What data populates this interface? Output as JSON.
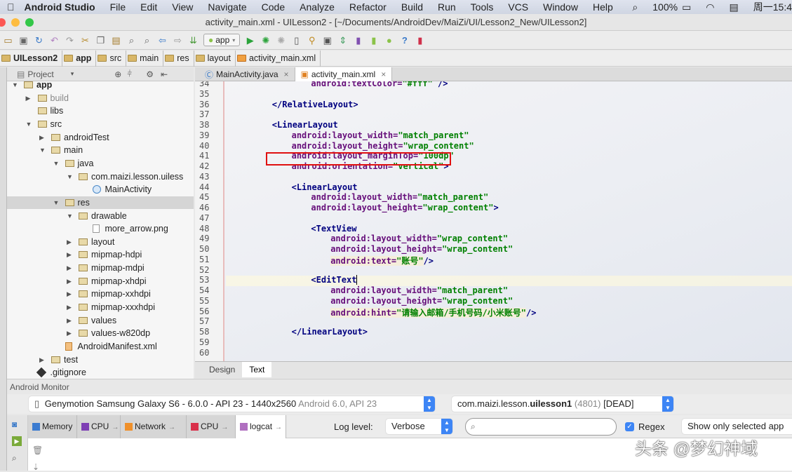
{
  "menubar": {
    "apple": "",
    "app_name": "Android Studio",
    "items": [
      "File",
      "Edit",
      "View",
      "Navigate",
      "Code",
      "Analyze",
      "Refactor",
      "Build",
      "Run",
      "Tools",
      "VCS",
      "Window",
      "Help"
    ],
    "battery": "100%",
    "clock": "周一15:4"
  },
  "window": {
    "title": "activity_main.xml - UILesson2 - [~/Documents/AndroidDev/MaiZi/UI/Lesson2_New/UILesson2]"
  },
  "toolbar": {
    "run_config": "app",
    "help": "?"
  },
  "breadcrumb": [
    "UILesson2",
    "app",
    "src",
    "main",
    "res",
    "layout",
    "activity_main.xml"
  ],
  "project_panel": {
    "view_selector": "Project"
  },
  "tree": [
    {
      "label": "app",
      "depth": 0,
      "arrow": "open",
      "bold": true
    },
    {
      "label": "build",
      "depth": 1,
      "arrow": "closed",
      "muted": true
    },
    {
      "label": "libs",
      "depth": 1,
      "arrow": "none"
    },
    {
      "label": "src",
      "depth": 1,
      "arrow": "open"
    },
    {
      "label": "androidTest",
      "depth": 2,
      "arrow": "closed"
    },
    {
      "label": "main",
      "depth": 2,
      "arrow": "open"
    },
    {
      "label": "java",
      "depth": 3,
      "arrow": "open"
    },
    {
      "label": "com.maizi.lesson.uiless",
      "depth": 4,
      "arrow": "open"
    },
    {
      "label": "MainActivity",
      "depth": 5,
      "arrow": "none",
      "icon": "class"
    },
    {
      "label": "res",
      "depth": 3,
      "arrow": "open",
      "selected": true
    },
    {
      "label": "drawable",
      "depth": 4,
      "arrow": "open"
    },
    {
      "label": "more_arrow.png",
      "depth": 5,
      "arrow": "none",
      "icon": "image"
    },
    {
      "label": "layout",
      "depth": 4,
      "arrow": "closed"
    },
    {
      "label": "mipmap-hdpi",
      "depth": 4,
      "arrow": "closed"
    },
    {
      "label": "mipmap-mdpi",
      "depth": 4,
      "arrow": "closed"
    },
    {
      "label": "mipmap-xhdpi",
      "depth": 4,
      "arrow": "closed"
    },
    {
      "label": "mipmap-xxhdpi",
      "depth": 4,
      "arrow": "closed"
    },
    {
      "label": "mipmap-xxxhdpi",
      "depth": 4,
      "arrow": "closed"
    },
    {
      "label": "values",
      "depth": 4,
      "arrow": "closed"
    },
    {
      "label": "values-w820dp",
      "depth": 4,
      "arrow": "closed"
    },
    {
      "label": "AndroidManifest.xml",
      "depth": 3,
      "arrow": "none",
      "icon": "manifest"
    },
    {
      "label": "test",
      "depth": 2,
      "arrow": "closed"
    },
    {
      "label": ".gitignore",
      "depth": 1,
      "arrow": "none",
      "icon": "git"
    }
  ],
  "editor_tabs": [
    {
      "label": "MainActivity.java",
      "active": false
    },
    {
      "label": "activity_main.xml",
      "active": true
    }
  ],
  "code": {
    "current_line": 53,
    "highlighted_line": 41,
    "lines": [
      {
        "n": 34,
        "indent": 3,
        "parts": [
          {
            "k": "attr",
            "t": "android:textColor="
          },
          {
            "k": "val",
            "t": "\"#fff\""
          },
          {
            "k": "tag",
            "t": " />"
          }
        ]
      },
      {
        "n": 35,
        "indent": 0,
        "parts": []
      },
      {
        "n": 36,
        "indent": 1,
        "parts": [
          {
            "k": "tag",
            "t": "</RelativeLayout>"
          }
        ]
      },
      {
        "n": 37,
        "indent": 0,
        "parts": []
      },
      {
        "n": 38,
        "indent": 1,
        "parts": [
          {
            "k": "tag",
            "t": "<LinearLayout"
          }
        ]
      },
      {
        "n": 39,
        "indent": 2,
        "parts": [
          {
            "k": "attr",
            "t": "android:layout_width="
          },
          {
            "k": "val",
            "t": "\"match_parent\""
          }
        ]
      },
      {
        "n": 40,
        "indent": 2,
        "parts": [
          {
            "k": "attr",
            "t": "android:layout_height="
          },
          {
            "k": "val",
            "t": "\"wrap_content\""
          }
        ]
      },
      {
        "n": 41,
        "indent": 2,
        "parts": [
          {
            "k": "attr",
            "t": "android:layout_marginTop="
          },
          {
            "k": "val",
            "t": "\"100dp\""
          }
        ]
      },
      {
        "n": 42,
        "indent": 2,
        "parts": [
          {
            "k": "attr",
            "t": "android:orientation="
          },
          {
            "k": "val",
            "t": "\"vertical\""
          },
          {
            "k": "tag",
            "t": ">"
          }
        ]
      },
      {
        "n": 43,
        "indent": 0,
        "parts": []
      },
      {
        "n": 44,
        "indent": 2,
        "parts": [
          {
            "k": "tag",
            "t": "<LinearLayout"
          }
        ]
      },
      {
        "n": 45,
        "indent": 3,
        "parts": [
          {
            "k": "attr",
            "t": "android:layout_width="
          },
          {
            "k": "val",
            "t": "\"match_parent\""
          }
        ]
      },
      {
        "n": 46,
        "indent": 3,
        "parts": [
          {
            "k": "attr",
            "t": "android:layout_height="
          },
          {
            "k": "val",
            "t": "\"wrap_content\""
          },
          {
            "k": "tag",
            "t": ">"
          }
        ]
      },
      {
        "n": 47,
        "indent": 0,
        "parts": []
      },
      {
        "n": 48,
        "indent": 3,
        "parts": [
          {
            "k": "tag",
            "t": "<TextView"
          }
        ]
      },
      {
        "n": 49,
        "indent": 4,
        "parts": [
          {
            "k": "attr",
            "t": "android:layout_width="
          },
          {
            "k": "val",
            "t": "\"wrap_content\""
          }
        ]
      },
      {
        "n": 50,
        "indent": 4,
        "parts": [
          {
            "k": "attr",
            "t": "android:layout_height="
          },
          {
            "k": "val",
            "t": "\"wrap_content\""
          }
        ]
      },
      {
        "n": 51,
        "indent": 4,
        "parts": [
          {
            "k": "attr hl",
            "t": "android:text="
          },
          {
            "k": "val hl",
            "t": "\"账号\""
          },
          {
            "k": "tag",
            "t": "/>"
          }
        ]
      },
      {
        "n": 52,
        "indent": 0,
        "parts": []
      },
      {
        "n": 53,
        "indent": 3,
        "parts": [
          {
            "k": "tag",
            "t": "<EditText"
          }
        ]
      },
      {
        "n": 54,
        "indent": 4,
        "parts": [
          {
            "k": "attr",
            "t": "android:layout_width="
          },
          {
            "k": "val",
            "t": "\"match_parent\""
          }
        ]
      },
      {
        "n": 55,
        "indent": 4,
        "parts": [
          {
            "k": "attr",
            "t": "android:layout_height="
          },
          {
            "k": "val",
            "t": "\"wrap_content\""
          }
        ]
      },
      {
        "n": 56,
        "indent": 4,
        "parts": [
          {
            "k": "attr hl",
            "t": "android:hint="
          },
          {
            "k": "val hl",
            "t": "\"请输入邮箱/手机号码/小米账号\""
          },
          {
            "k": "tag",
            "t": "/>"
          }
        ]
      },
      {
        "n": 57,
        "indent": 0,
        "parts": []
      },
      {
        "n": 58,
        "indent": 2,
        "parts": [
          {
            "k": "tag",
            "t": "</LinearLayout>"
          }
        ]
      },
      {
        "n": 59,
        "indent": 0,
        "parts": []
      },
      {
        "n": 60,
        "indent": 0,
        "parts": []
      }
    ]
  },
  "editor_bottom_tabs": [
    {
      "label": "Design",
      "active": false
    },
    {
      "label": "Text",
      "active": true
    }
  ],
  "monitor": {
    "title": "Android Monitor",
    "device": {
      "name": "Genymotion Samsung Galaxy S6 - 6.0.0 - API 23 - 1440x2560",
      "detail": "Android 6.0, API 23"
    },
    "process": {
      "prefix": "com.maizi.lesson.",
      "app": "uilesson1",
      "pid": "(4801)",
      "state": "[DEAD]"
    },
    "tabs": [
      {
        "label": "Memory",
        "color": "#3b7bd0"
      },
      {
        "label": "CPU",
        "color": "#7e3fb4"
      },
      {
        "label": "Network",
        "color": "#f0902a"
      },
      {
        "label": "CPU",
        "color": "#d9304a"
      },
      {
        "label": "logcat",
        "color": "#b070c0",
        "active": true
      }
    ],
    "log_level_label": "Log level:",
    "log_level": "Verbose",
    "search_value": "",
    "regex_label": "Regex",
    "regex_checked": true,
    "filter": "Show only selected app"
  },
  "watermark": "头条 @梦幻神域",
  "colors": {
    "accent": "#3d85f5",
    "highlight_box": "#e01010",
    "tag": "#000080",
    "attr": "#660e7a",
    "value": "#008000"
  }
}
